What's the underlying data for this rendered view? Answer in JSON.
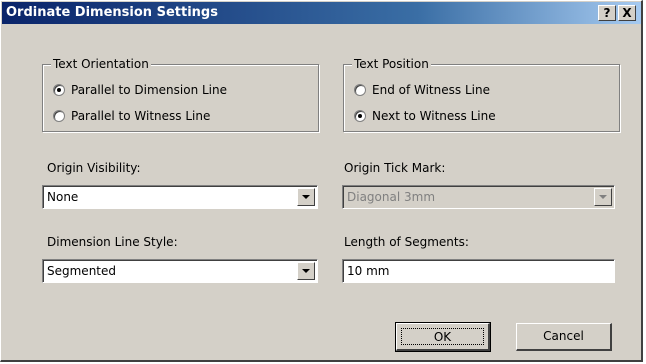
{
  "window": {
    "title": "Ordinate Dimension Settings",
    "help_label": "?",
    "close_label": "X"
  },
  "text_orientation": {
    "legend": "Text Orientation",
    "options": [
      {
        "label": "Parallel to Dimension Line",
        "checked": true
      },
      {
        "label": "Parallel to Witness Line",
        "checked": false
      }
    ]
  },
  "text_position": {
    "legend": "Text Position",
    "options": [
      {
        "label": "End of Witness Line",
        "checked": false
      },
      {
        "label": "Next to Witness Line",
        "checked": true
      }
    ]
  },
  "origin_visibility": {
    "label": "Origin Visibility:",
    "value": "None"
  },
  "origin_tick_mark": {
    "label": "Origin Tick Mark:",
    "value": "Diagonal 3mm",
    "disabled": true
  },
  "dimension_line_style": {
    "label": "Dimension Line Style:",
    "value": "Segmented"
  },
  "length_of_segments": {
    "label": "Length of Segments:",
    "value": "10 mm"
  },
  "buttons": {
    "ok_label": "OK",
    "cancel_label": "Cancel"
  },
  "colors": {
    "title_gradient_start": "#0a246a",
    "title_gradient_end": "#a6caf0",
    "dialog_face": "#d4d0c8",
    "disabled_text": "#808080"
  }
}
